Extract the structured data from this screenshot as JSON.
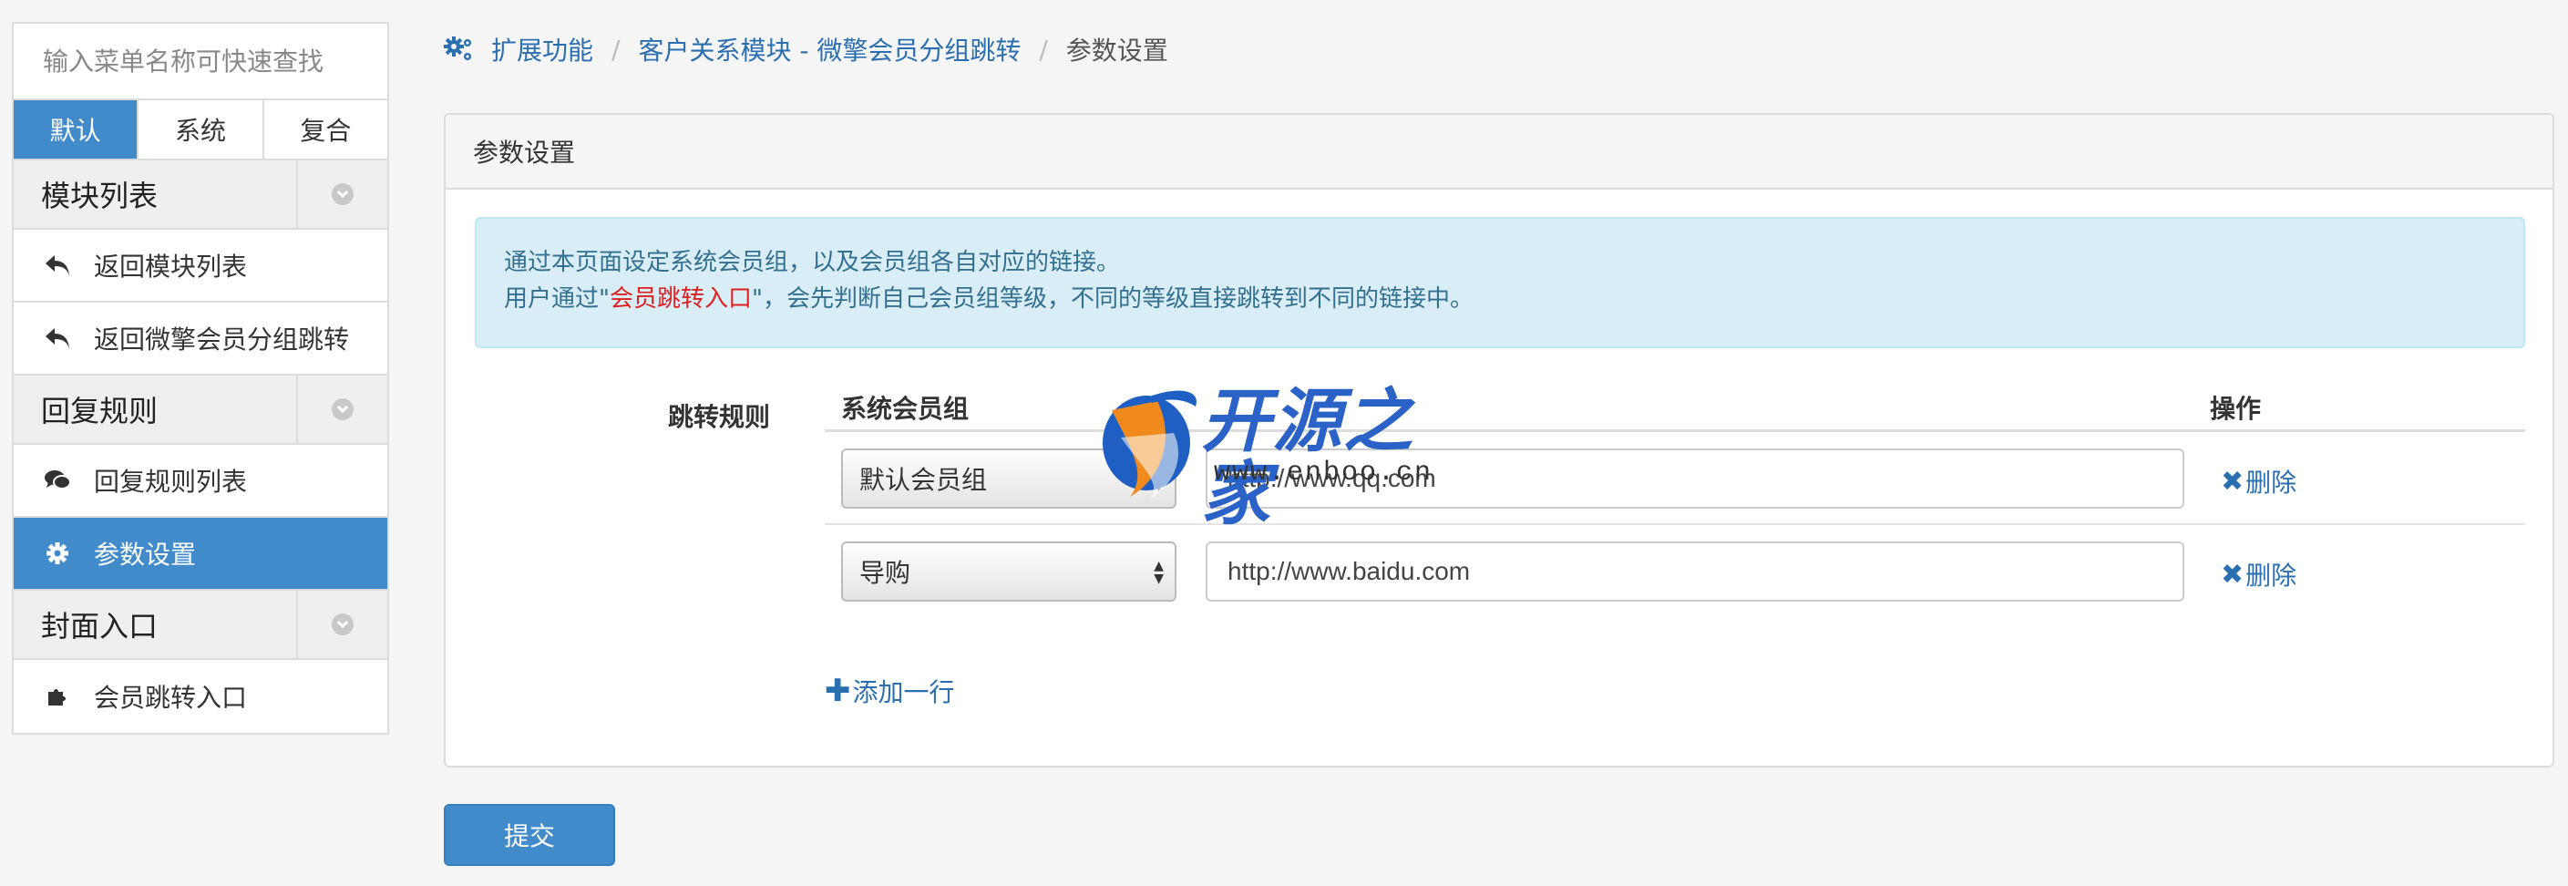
{
  "sidebar": {
    "search_placeholder": "输入菜单名称可快速查找",
    "tabs": [
      {
        "label": "默认",
        "active": true
      },
      {
        "label": "系统",
        "active": false
      },
      {
        "label": "复合",
        "active": false
      }
    ],
    "groups": [
      {
        "title": "模块列表",
        "items": [
          {
            "label": "返回模块列表",
            "icon": "reply-icon",
            "active": false
          },
          {
            "label": "返回微擎会员分组跳转",
            "icon": "reply-icon",
            "active": false
          }
        ]
      },
      {
        "title": "回复规则",
        "items": [
          {
            "label": "回复规则列表",
            "icon": "comments-icon",
            "active": false
          },
          {
            "label": "参数设置",
            "icon": "gear-icon",
            "active": true
          }
        ]
      },
      {
        "title": "封面入口",
        "items": [
          {
            "label": "会员跳转入口",
            "icon": "puzzle-icon",
            "active": false
          }
        ]
      }
    ]
  },
  "breadcrumb": {
    "icon": "cogs-icon",
    "items": [
      "扩展功能",
      "客户关系模块 - 微擎会员分组跳转",
      "参数设置"
    ]
  },
  "panel": {
    "heading": "参数设置",
    "alert": {
      "line1": "通过本页面设定系统会员组，以及会员组各自对应的链接。",
      "line2_pre": "用户通过\"",
      "line2_highlight": "会员跳转入口",
      "line2_post": "\"，会先判断自己会员组等级，不同的等级直接跳转到不同的链接中。"
    },
    "form_label": "跳转规则",
    "table": {
      "headers": {
        "group": "系统会员组",
        "action": "操作"
      },
      "rows": [
        {
          "group": "默认会员组",
          "url": "http://www.qq.com",
          "delete_label": "删除"
        },
        {
          "group": "导购",
          "url": "http://www.baidu.com",
          "delete_label": "删除"
        }
      ]
    },
    "add_row_label": "添加一行"
  },
  "submit_label": "提交",
  "watermark": {
    "brand": "开源之家",
    "url": "www.enboo.cn"
  },
  "colors": {
    "primary": "#428bca",
    "link": "#2a6fb0",
    "alert_bg": "#d9edf7",
    "alert_text": "#31708f",
    "highlight": "#e02020"
  }
}
